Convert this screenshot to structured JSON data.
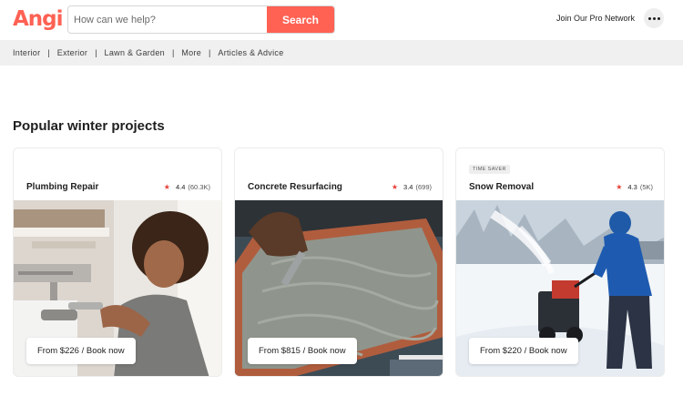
{
  "header": {
    "logo_text": "Angi",
    "search_placeholder": "How can we help?",
    "search_button": "Search",
    "pro_link": "Join Our Pro Network",
    "brand_color": "#ff6153"
  },
  "nav": {
    "items": [
      "Interior",
      "Exterior",
      "Lawn & Garden",
      "More",
      "Articles & Advice"
    ]
  },
  "section": {
    "title": "Popular winter projects"
  },
  "cards": [
    {
      "title": "Plumbing Repair",
      "rating": "4.4",
      "reviews": "(60.3K)",
      "badge": "",
      "price_label": "From $226 / Book now",
      "image": "plumber-photo"
    },
    {
      "title": "Concrete Resurfacing",
      "rating": "3.4",
      "reviews": "(699)",
      "badge": "",
      "price_label": "From $815 / Book now",
      "image": "trowel-concrete-photo"
    },
    {
      "title": "Snow Removal",
      "rating": "4.3",
      "reviews": "(5K)",
      "badge": "TIME SAVER",
      "price_label": "From $220 / Book now",
      "image": "snowblower-photo"
    }
  ]
}
